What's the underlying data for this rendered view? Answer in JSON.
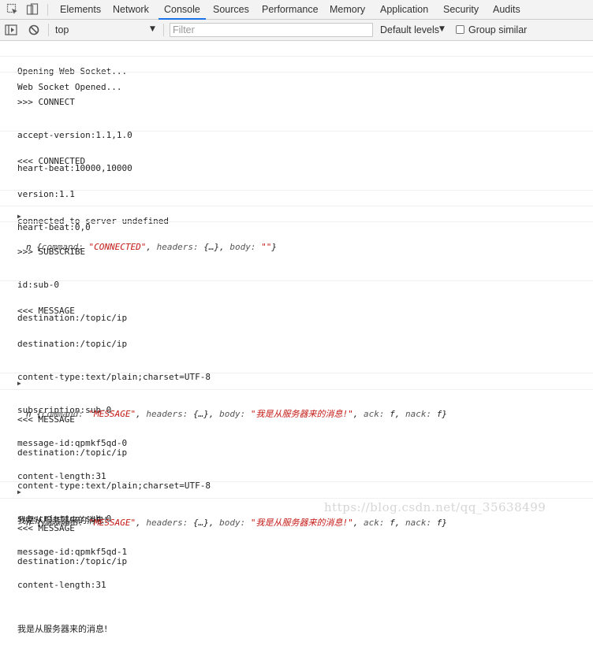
{
  "tabs": [
    "Elements",
    "Network",
    "Console",
    "Sources",
    "Performance",
    "Memory",
    "Application",
    "Security",
    "Audits"
  ],
  "active_tab": "Console",
  "toolbar": {
    "context": "top",
    "filter_placeholder": "Filter",
    "levels": "Default levels",
    "group_similar": "Group similar"
  },
  "messages": {
    "m0": "Opening Web Socket...",
    "m1": "Web Socket Opened...",
    "m2": [
      ">>> CONNECT",
      "accept-version:1.1,1.0",
      "heart-beat:10000,10000"
    ],
    "m3": [
      "<<< CONNECTED",
      "version:1.1",
      "heart-beat:0,0"
    ],
    "m4": "connected to server undefined",
    "o1": {
      "cls": "n",
      "command": "\"CONNECTED\"",
      "body": "\"\""
    },
    "m5": [
      ">>> SUBSCRIBE",
      "id:sub-0",
      "destination:/topic/ip"
    ],
    "m6": [
      "<<< MESSAGE",
      "destination:/topic/ip",
      "content-type:text/plain;charset=UTF-8",
      "subscription:sub-0",
      "message-id:qpmkf5qd-0",
      "content-length:31",
      "我是从服务器来的消息!"
    ],
    "o2": {
      "cls": "n",
      "command": "\"MESSAGE\"",
      "body": "\"我是从服务器来的消息!\"",
      "ack": "f",
      "nack": "f"
    },
    "m7": [
      "<<< MESSAGE",
      "destination:/topic/ip",
      "content-type:text/plain;charset=UTF-8",
      "subscription:sub-0",
      "message-id:qpmkf5qd-1",
      "content-length:31",
      "我是从服务器来的消息!"
    ],
    "o3": {
      "cls": "n",
      "command": "\"MESSAGE\"",
      "body": "\"我是从服务器来的消息!\"",
      "ack": "f",
      "nack": "f"
    },
    "m8": [
      "<<< MESSAGE",
      "destination:/topic/ip"
    ]
  },
  "watermark": "https://blog.csdn.net/qq_35638499"
}
